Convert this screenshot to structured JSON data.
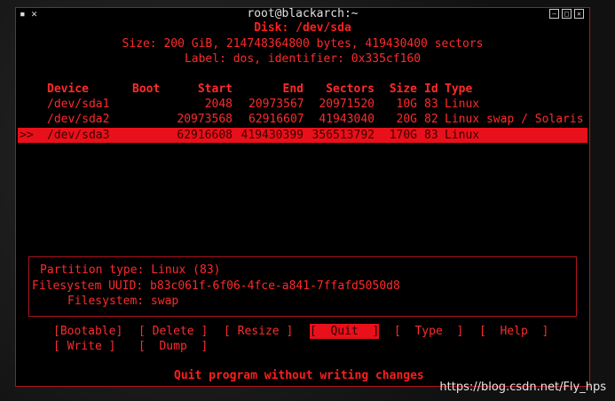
{
  "window": {
    "title": "root@blackarch:~",
    "controls": [
      "minimize-icon",
      "maximize-icon",
      "close-icon"
    ]
  },
  "disk": {
    "line": "Disk: /dev/sda",
    "size_line": "Size: 200 GiB, 214748364800 bytes, 419430400 sectors",
    "label_line": "Label: dos, identifier: 0x335cf160"
  },
  "table": {
    "headers": [
      "Device",
      "Boot",
      "Start",
      "End",
      "Sectors",
      "Size",
      "Id",
      "Type"
    ],
    "rows": [
      {
        "marker": "",
        "device": "/dev/sda1",
        "boot": "",
        "start": "2048",
        "end": "20973567",
        "sectors": "20971520",
        "size": "10G",
        "id": "83",
        "type": "Linux"
      },
      {
        "marker": "",
        "device": "/dev/sda2",
        "boot": "",
        "start": "20973568",
        "end": "62916607",
        "sectors": "41943040",
        "size": "20G",
        "id": "82",
        "type": "Linux swap / Solaris"
      },
      {
        "marker": ">>",
        "device": "/dev/sda3",
        "boot": "",
        "start": "62916608",
        "end": "419430399",
        "sectors": "356513792",
        "size": "170G",
        "id": "83",
        "type": "Linux"
      }
    ]
  },
  "info": {
    "partition_type": "Partition type: Linux (83)",
    "fs_uuid": "Filesystem UUID: b83c061f-6f06-4fce-a841-7ffafd5050d8",
    "filesystem": "Filesystem: swap"
  },
  "menu": {
    "bootable": "[Bootable]",
    "delete": "[ Delete ]",
    "resize": "[ Resize ]",
    "quit": "[  Quit  ]",
    "type": "[  Type  ]",
    "help": "[  Help  ]",
    "write": "[ Write ]",
    "dump": "[  Dump  ]"
  },
  "status": "Quit program without writing changes",
  "watermark": "https://blog.csdn.net/Fly_hps"
}
